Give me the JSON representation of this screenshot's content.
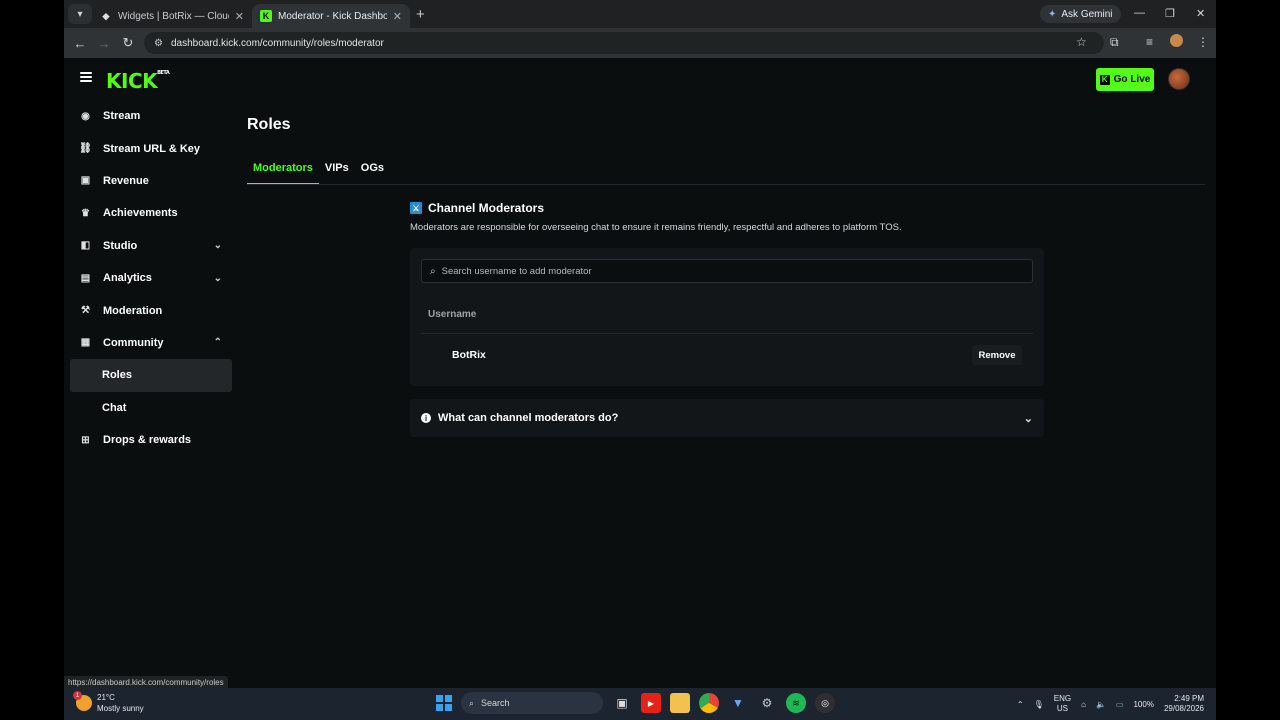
{
  "browser": {
    "tabs": [
      {
        "title": "Widgets | BotRix — Cloud Stream",
        "icon": "botrix-favicon",
        "active": false
      },
      {
        "title": "Moderator - Kick Dashboard",
        "icon": "kick-favicon",
        "active": true
      }
    ],
    "ask_gemini": "Ask Gemini",
    "url": "dashboard.kick.com/community/roles/moderator",
    "status_url": "https://dashboard.kick.com/community/roles"
  },
  "header": {
    "logo": "KICK",
    "logo_badge": "BETA",
    "go_live": "Go Live"
  },
  "sidebar": {
    "items": [
      {
        "label": "Stream",
        "icon": "stream-icon"
      },
      {
        "label": "Stream URL & Key",
        "icon": "link-icon"
      },
      {
        "label": "Revenue",
        "icon": "revenue-icon"
      },
      {
        "label": "Achievements",
        "icon": "trophy-icon"
      },
      {
        "label": "Studio",
        "icon": "studio-icon",
        "expandable": true
      },
      {
        "label": "Analytics",
        "icon": "analytics-icon",
        "expandable": true
      },
      {
        "label": "Moderation",
        "icon": "hammer-icon"
      },
      {
        "label": "Community",
        "icon": "community-icon",
        "expanded": true
      },
      {
        "label": "Roles",
        "sub": true,
        "selected": true
      },
      {
        "label": "Chat",
        "sub": true
      },
      {
        "label": "Drops & rewards",
        "icon": "gift-icon"
      }
    ]
  },
  "main": {
    "title": "Roles",
    "tabs": [
      "Moderators",
      "VIPs",
      "OGs"
    ],
    "active_tab": "Moderators",
    "section_title": "Channel Moderators",
    "section_desc": "Moderators are responsible for overseeing chat to ensure it remains friendly, respectful and adheres to platform TOS.",
    "search_placeholder": "Search username to add moderator",
    "column_username": "Username",
    "moderators": [
      {
        "username": "BotRix",
        "action": "Remove"
      }
    ],
    "faq_title": "What can channel moderators do?"
  },
  "taskbar": {
    "weather_temp": "21°C",
    "weather_desc": "Mostly sunny",
    "weather_badge": "1",
    "search_label": "Search",
    "lang_1": "ENG",
    "lang_2": "US",
    "battery": "100%",
    "time": "2:49 PM",
    "date": "29/08/2026"
  }
}
